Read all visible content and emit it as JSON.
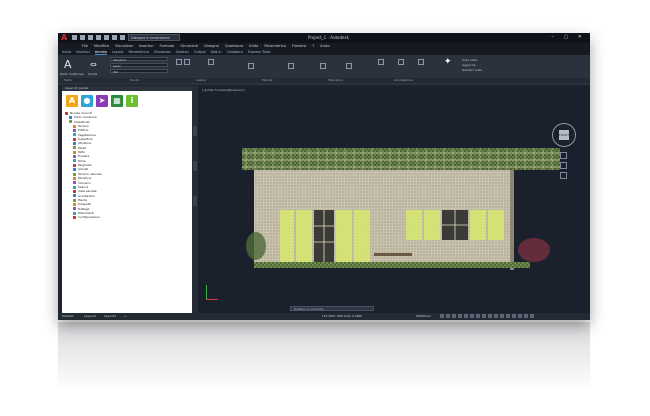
{
  "app": {
    "logo_letter": "A",
    "title": "Project_1 - Autodesk",
    "workspace": "Disegno e annotazioni"
  },
  "menus": [
    "File",
    "Modifica",
    "Visualizza",
    "Inserisci",
    "Formato",
    "Strumenti",
    "Disegna",
    "Quotatura",
    "Edita",
    "Parametrico",
    "Finestra",
    "?",
    "Aiuto"
  ],
  "tabs": [
    "Inizio",
    "Inserisci",
    "Annota",
    "Layout",
    "Parametrico",
    "Visualizza",
    "Gestisci",
    "Output",
    "Add-in",
    "Collabora",
    "Express Tools"
  ],
  "active_tab": "Annota",
  "ribbon": {
    "text_label": "Testo multilinea",
    "dim_label": "Quota",
    "style_combo": "Standard",
    "layer_combo": "Layer",
    "annotation_combo": "ISO",
    "panels": [
      "Testo",
      "Quote",
      "Leader",
      "Tabelle",
      "Marcature",
      "Annotazione"
    ],
    "right_items": [
      "Crea vista",
      "Aggiorna",
      "Gestisci viste"
    ]
  },
  "panel": {
    "title": "Layer di nuvola",
    "tree": [
      "Nuvola di punti",
      "Punti scansione",
      "Classificati",
      "Terreno",
      "Edificio",
      "Vegetazione",
      "Superficie",
      "Struttura",
      "Pareti",
      "Tetto",
      "Finestre",
      "Porte",
      "Pergolato",
      "Arbusti",
      "Terreno naturale",
      "Muratura",
      "Intonaco",
      "Sezioni",
      "Viste salvate",
      "Annotazioni",
      "Piante",
      "Prospetti",
      "Dettagli",
      "Riferimenti",
      "Configurazione"
    ]
  },
  "viewport": {
    "label": "[-][Vista frontale][Realistico]"
  },
  "navcube": {
    "face": "FRONTALE"
  },
  "status": {
    "layout_tabs": [
      "Modello",
      "Layout1",
      "Layout2"
    ],
    "command_placeholder": "Digitare un comando",
    "coords": "123.4567, 890.1234, 0.0000",
    "model_label": "MODELLO"
  },
  "colors": {
    "accent": "#4d8fd6",
    "highlight": "#d9ec6a"
  }
}
